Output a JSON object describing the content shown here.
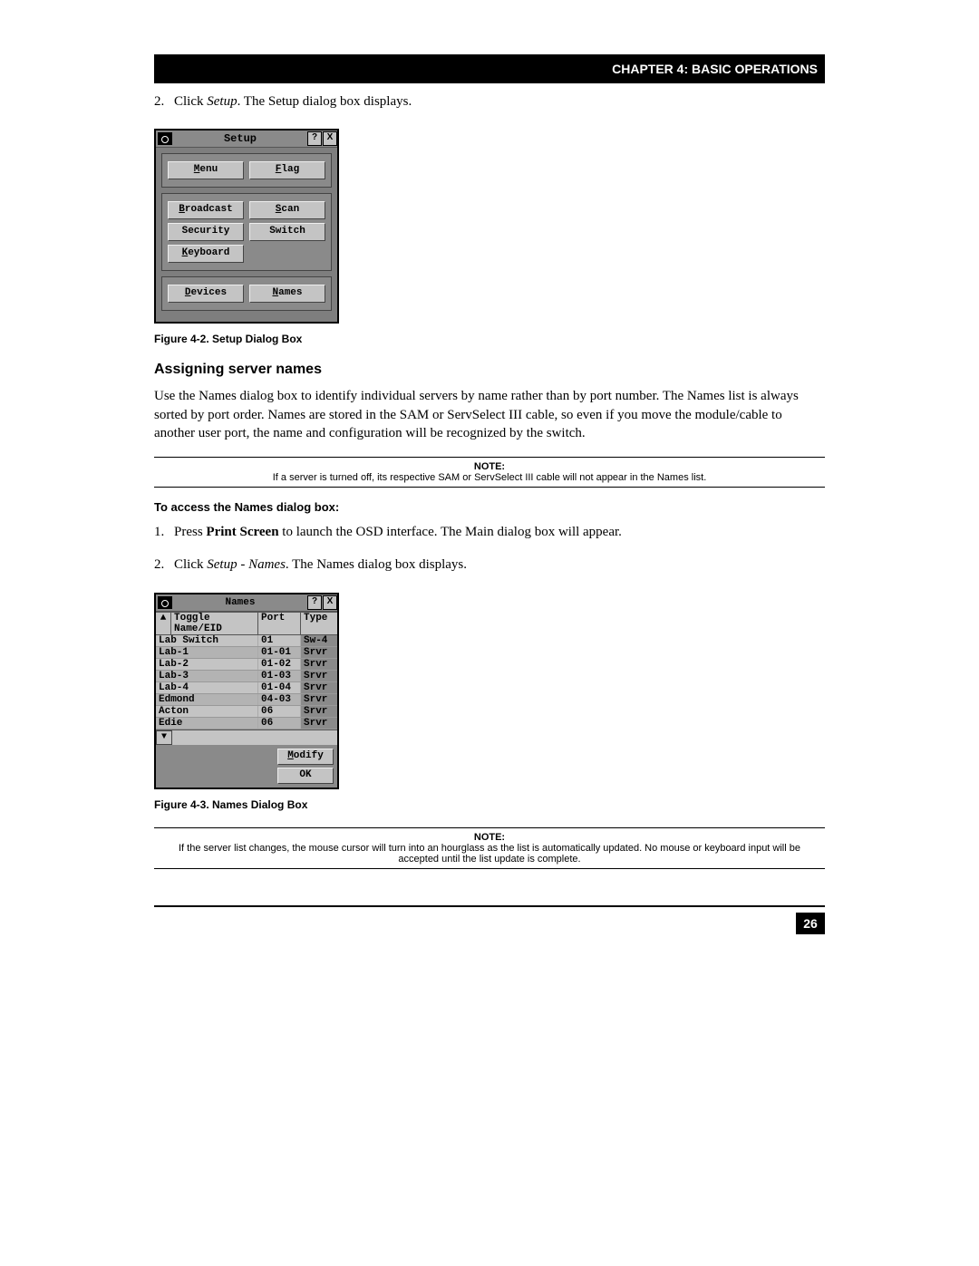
{
  "header": "CHAPTER 4: BASIC OPERATIONS",
  "step2": {
    "num": "2.",
    "pre": "Click ",
    "em": "Setup",
    "post": ". The Setup dialog box displays."
  },
  "setup_dialog": {
    "title": "Setup",
    "help": "?",
    "close": "X",
    "buttons": {
      "menu": "Menu",
      "flag": "Flag",
      "broadcast": "Broadcast",
      "scan": "Scan",
      "security": "Security",
      "switch": "Switch",
      "keyboard": "Keyboard",
      "devices": "Devices",
      "names": "Names"
    }
  },
  "fig42": "Figure 4-2.  Setup Dialog Box",
  "section_heading": "Assigning server names",
  "para1": "Use the Names dialog box to identify individual servers by name rather than by port number. The Names list is always sorted by port order. Names are stored in the SAM or ServSelect III cable, so even if you move the module/cable to another user port, the name and configuration will be recognized by the switch.",
  "note1": {
    "label": "NOTE:",
    "text": "If a server is turned off, its respective SAM or ServSelect III cable will not appear in the Names list."
  },
  "sub_heading": "To access the Names dialog box:",
  "step_a": {
    "num": "1.",
    "pre": "Press ",
    "bold": "Print Screen",
    "post": " to launch the OSD interface. The Main dialog box will appear."
  },
  "step_b": {
    "num": "2.",
    "pre": "Click ",
    "em": "Setup - Names",
    "post": ". The Names dialog box displays."
  },
  "names_dialog": {
    "title": "Names",
    "help": "?",
    "close": "X",
    "toggle_icon_up": "▲",
    "col_name": "Toggle Name/EID",
    "col_port": "Port",
    "col_type": "Type",
    "rows": [
      {
        "name": "Lab Switch",
        "port": "01",
        "type": "Sw-4"
      },
      {
        "name": "Lab-1",
        "port": "01-01",
        "type": "Srvr"
      },
      {
        "name": "Lab-2",
        "port": "01-02",
        "type": "Srvr"
      },
      {
        "name": "Lab-3",
        "port": "01-03",
        "type": "Srvr"
      },
      {
        "name": "Lab-4",
        "port": "01-04",
        "type": "Srvr"
      },
      {
        "name": "Edmond",
        "port": "04-03",
        "type": "Srvr"
      },
      {
        "name": "Acton",
        "port": "06",
        "type": "Srvr"
      },
      {
        "name": "Edie",
        "port": "06",
        "type": "Srvr"
      }
    ],
    "scroll_down": "▼",
    "modify": "Modify",
    "ok": "OK"
  },
  "fig43": "Figure 4-3.  Names Dialog Box",
  "note2": {
    "label": "NOTE:",
    "text": "If the server list changes, the mouse cursor will turn into an hourglass as the list is automatically updated. No mouse or keyboard input will be accepted until the list update is complete."
  },
  "page_number": "26"
}
